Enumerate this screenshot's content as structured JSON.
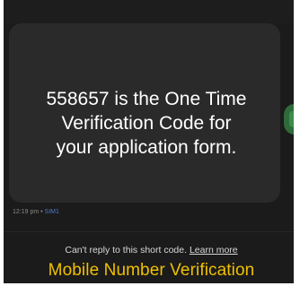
{
  "message": {
    "text": "558657 is the One Time Verification Code for your application form."
  },
  "meta": {
    "time": "12:19 pm",
    "separator": " • ",
    "sim": "SIM1"
  },
  "reply_notice": {
    "text": "Can't reply to this short code. ",
    "link_label": "Learn more"
  },
  "caption": {
    "text": "Mobile Number Verification"
  },
  "colors": {
    "caption": "#f0c000",
    "sim_label": "#4d79c7",
    "side_button": "#2f6b3a"
  }
}
